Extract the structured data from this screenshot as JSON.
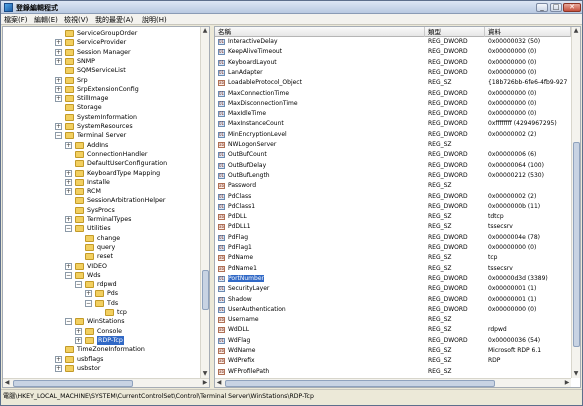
{
  "window": {
    "title": "登錄編輯程式",
    "min_label": "_",
    "max_label": "□",
    "close_label": "✕"
  },
  "menu": [
    "檔案(F)",
    "編輯(E)",
    "檢視(V)",
    "我的最愛(A)",
    "說明(H)"
  ],
  "tree": [
    {
      "label": "ServiceGroupOrder",
      "depth": 4,
      "expander": ""
    },
    {
      "label": "ServiceProvider",
      "depth": 4,
      "expander": "+"
    },
    {
      "label": "Session Manager",
      "depth": 4,
      "expander": "+"
    },
    {
      "label": "SNMP",
      "depth": 4,
      "expander": "+"
    },
    {
      "label": "SQMServiceList",
      "depth": 4,
      "expander": ""
    },
    {
      "label": "Srp",
      "depth": 4,
      "expander": "+"
    },
    {
      "label": "SrpExtensionConfig",
      "depth": 4,
      "expander": "+"
    },
    {
      "label": "StillImage",
      "depth": 4,
      "expander": "+"
    },
    {
      "label": "Storage",
      "depth": 4,
      "expander": ""
    },
    {
      "label": "SystemInformation",
      "depth": 4,
      "expander": ""
    },
    {
      "label": "SystemResources",
      "depth": 4,
      "expander": "+"
    },
    {
      "label": "Terminal Server",
      "depth": 4,
      "expander": "−"
    },
    {
      "label": "AddIns",
      "depth": 5,
      "expander": "+"
    },
    {
      "label": "ConnectionHandler",
      "depth": 5,
      "expander": ""
    },
    {
      "label": "DefaultUserConfiguration",
      "depth": 5,
      "expander": ""
    },
    {
      "label": "KeyboardType Mapping",
      "depth": 5,
      "expander": "+"
    },
    {
      "label": "Installe",
      "depth": 5,
      "expander": "+"
    },
    {
      "label": "RCM",
      "depth": 5,
      "expander": "+"
    },
    {
      "label": "SessionArbitrationHelper",
      "depth": 5,
      "expander": ""
    },
    {
      "label": "SysProcs",
      "depth": 5,
      "expander": ""
    },
    {
      "label": "TerminalTypes",
      "depth": 5,
      "expander": "+"
    },
    {
      "label": "Utilities",
      "depth": 5,
      "expander": "−"
    },
    {
      "label": "change",
      "depth": 6,
      "expander": ""
    },
    {
      "label": "query",
      "depth": 6,
      "expander": ""
    },
    {
      "label": "reset",
      "depth": 6,
      "expander": ""
    },
    {
      "label": "VIDEO",
      "depth": 5,
      "expander": "+"
    },
    {
      "label": "Wds",
      "depth": 5,
      "expander": "−"
    },
    {
      "label": "rdpwd",
      "depth": 6,
      "expander": "−"
    },
    {
      "label": "Pds",
      "depth": 7,
      "expander": "+"
    },
    {
      "label": "Tds",
      "depth": 7,
      "expander": "−"
    },
    {
      "label": "tcp",
      "depth": 8,
      "expander": ""
    },
    {
      "label": "WinStations",
      "depth": 5,
      "expander": "−"
    },
    {
      "label": "Console",
      "depth": 6,
      "expander": "+"
    },
    {
      "label": "RDP-Tcp",
      "depth": 6,
      "expander": "+",
      "selected": true
    },
    {
      "label": "TimeZoneInformation",
      "depth": 4,
      "expander": ""
    },
    {
      "label": "usbflags",
      "depth": 4,
      "expander": "+"
    },
    {
      "label": "usbstor",
      "depth": 4,
      "expander": "+"
    }
  ],
  "list": {
    "headers": [
      "名稱",
      "類型",
      "資料"
    ],
    "rows": [
      {
        "kind": "num",
        "name": "InteractiveDelay",
        "type": "REG_DWORD",
        "data": "0x00000032 (50)"
      },
      {
        "kind": "num",
        "name": "KeepAliveTimeout",
        "type": "REG_DWORD",
        "data": "0x00000000 (0)"
      },
      {
        "kind": "num",
        "name": "KeyboardLayout",
        "type": "REG_DWORD",
        "data": "0x00000000 (0)"
      },
      {
        "kind": "num",
        "name": "LanAdapter",
        "type": "REG_DWORD",
        "data": "0x00000000 (0)"
      },
      {
        "kind": "str",
        "name": "LoadableProtocol_Object",
        "type": "REG_SZ",
        "data": "{18b726bb-6fe6-4fb9-927"
      },
      {
        "kind": "num",
        "name": "MaxConnectionTime",
        "type": "REG_DWORD",
        "data": "0x00000000 (0)"
      },
      {
        "kind": "num",
        "name": "MaxDisconnectionTime",
        "type": "REG_DWORD",
        "data": "0x00000000 (0)"
      },
      {
        "kind": "num",
        "name": "MaxIdleTime",
        "type": "REG_DWORD",
        "data": "0x00000000 (0)"
      },
      {
        "kind": "num",
        "name": "MaxInstanceCount",
        "type": "REG_DWORD",
        "data": "0xffffffff (4294967295)"
      },
      {
        "kind": "num",
        "name": "MinEncryptionLevel",
        "type": "REG_DWORD",
        "data": "0x00000002 (2)"
      },
      {
        "kind": "str",
        "name": "NWLogonServer",
        "type": "REG_SZ",
        "data": ""
      },
      {
        "kind": "num",
        "name": "OutBufCount",
        "type": "REG_DWORD",
        "data": "0x00000006 (6)"
      },
      {
        "kind": "num",
        "name": "OutBufDelay",
        "type": "REG_DWORD",
        "data": "0x00000064 (100)"
      },
      {
        "kind": "num",
        "name": "OutBufLength",
        "type": "REG_DWORD",
        "data": "0x00000212 (530)"
      },
      {
        "kind": "str",
        "name": "Password",
        "type": "REG_SZ",
        "data": ""
      },
      {
        "kind": "num",
        "name": "PdClass",
        "type": "REG_DWORD",
        "data": "0x00000002 (2)"
      },
      {
        "kind": "num",
        "name": "PdClass1",
        "type": "REG_DWORD",
        "data": "0x0000000b (11)"
      },
      {
        "kind": "str",
        "name": "PdDLL",
        "type": "REG_SZ",
        "data": "tdtcp"
      },
      {
        "kind": "str",
        "name": "PdDLL1",
        "type": "REG_SZ",
        "data": "tssecsrv"
      },
      {
        "kind": "num",
        "name": "PdFlag",
        "type": "REG_DWORD",
        "data": "0x0000004e (78)"
      },
      {
        "kind": "num",
        "name": "PdFlag1",
        "type": "REG_DWORD",
        "data": "0x00000000 (0)"
      },
      {
        "kind": "str",
        "name": "PdName",
        "type": "REG_SZ",
        "data": "tcp"
      },
      {
        "kind": "str",
        "name": "PdName1",
        "type": "REG_SZ",
        "data": "tssecsrv"
      },
      {
        "kind": "num",
        "name": "PortNumber",
        "type": "REG_DWORD",
        "data": "0x00000d3d (3389)",
        "selected": true
      },
      {
        "kind": "num",
        "name": "SecurityLayer",
        "type": "REG_DWORD",
        "data": "0x00000001 (1)"
      },
      {
        "kind": "num",
        "name": "Shadow",
        "type": "REG_DWORD",
        "data": "0x00000001 (1)"
      },
      {
        "kind": "num",
        "name": "UserAuthentication",
        "type": "REG_DWORD",
        "data": "0x00000000 (0)"
      },
      {
        "kind": "str",
        "name": "Username",
        "type": "REG_SZ",
        "data": ""
      },
      {
        "kind": "str",
        "name": "WdDLL",
        "type": "REG_SZ",
        "data": "rdpwd"
      },
      {
        "kind": "num",
        "name": "WdFlag",
        "type": "REG_DWORD",
        "data": "0x00000036 (54)"
      },
      {
        "kind": "str",
        "name": "WdName",
        "type": "REG_SZ",
        "data": "Microsoft RDP 6.1"
      },
      {
        "kind": "str",
        "name": "WdPrefix",
        "type": "REG_SZ",
        "data": "RDP"
      },
      {
        "kind": "str",
        "name": "WFProfilePath",
        "type": "REG_SZ",
        "data": ""
      }
    ]
  },
  "icons": {
    "num_icon": "ab-binary",
    "str_icon": "ab-string",
    "folder_icon": "folder"
  },
  "colors": {
    "selection": "#3169c6"
  },
  "status": "電腦\\HKEY_LOCAL_MACHINE\\SYSTEM\\CurrentControlSet\\Control\\Terminal Server\\WinStations\\RDP-Tcp"
}
